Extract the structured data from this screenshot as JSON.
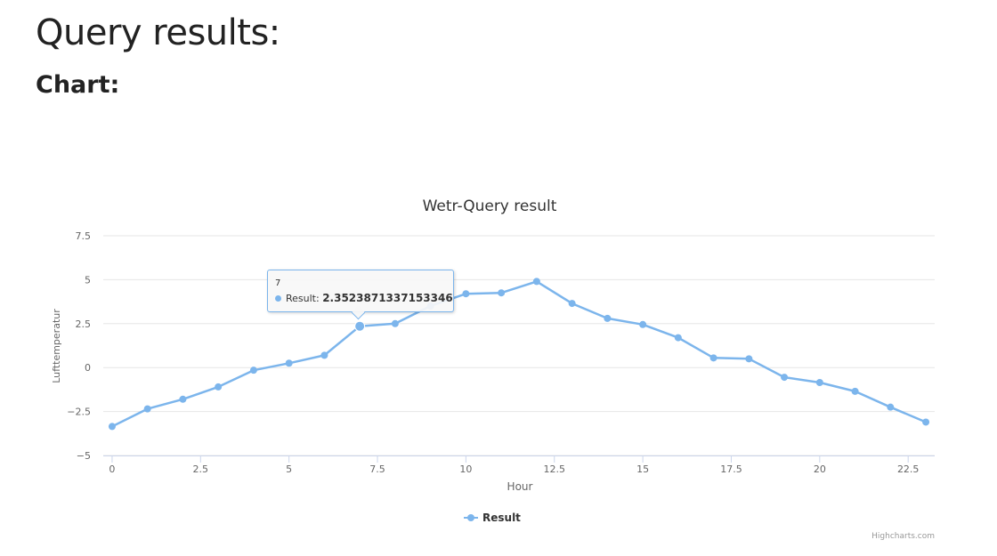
{
  "page": {
    "title": "Query results:",
    "section": "Chart:"
  },
  "colors": {
    "series": "#7cb5ec",
    "grid": "#e6e6e6",
    "axis_text": "#666666"
  },
  "tooltip": {
    "x": "7",
    "series_name": "Result",
    "value": "2.3523871337153346"
  },
  "credits": "Highcharts.com",
  "chart_data": {
    "type": "line",
    "title": "Wetr-Query result",
    "xlabel": "Hour",
    "ylabel": "Lufttemperatur",
    "xlim": [
      0,
      23
    ],
    "ylim": [
      -5,
      7.5
    ],
    "x_ticks": [
      "0",
      "2.5",
      "5",
      "7.5",
      "10",
      "12.5",
      "15",
      "17.5",
      "20",
      "22.5"
    ],
    "y_ticks": [
      "−5",
      "−2.5",
      "0",
      "2.5",
      "5",
      "7.5"
    ],
    "grid": true,
    "legend_position": "bottom-center",
    "series": [
      {
        "name": "Result",
        "x": [
          0,
          1,
          2,
          3,
          4,
          5,
          6,
          7,
          8,
          9,
          10,
          11,
          12,
          13,
          14,
          15,
          16,
          17,
          18,
          19,
          20,
          21,
          22,
          23
        ],
        "values": [
          -3.35,
          -2.35,
          -1.8,
          -1.1,
          -0.15,
          0.25,
          0.7,
          2.3523871337153346,
          2.5,
          3.5,
          4.2,
          4.25,
          4.9,
          3.65,
          2.8,
          2.45,
          1.7,
          0.55,
          0.5,
          -0.55,
          -0.85,
          -1.35,
          -2.25,
          -3.1
        ]
      }
    ]
  }
}
